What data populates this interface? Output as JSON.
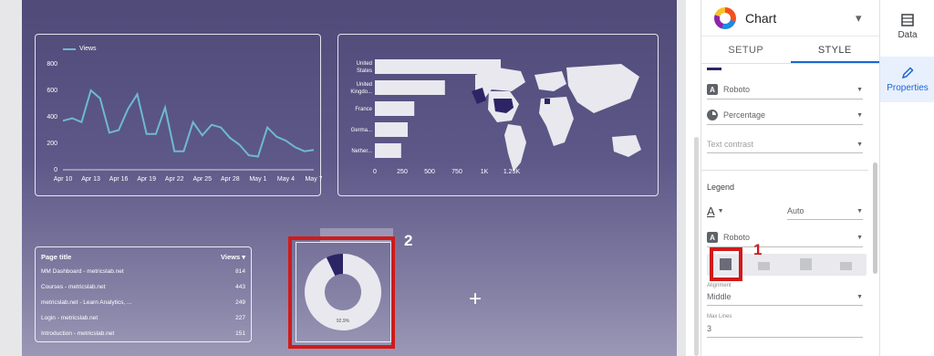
{
  "line_chart": {
    "legend": "Views",
    "x_labels": [
      "Apr 10",
      "Apr 13",
      "Apr 16",
      "Apr 19",
      "Apr 22",
      "Apr 25",
      "Apr 28",
      "May 1",
      "May 4",
      "May 7"
    ],
    "y_labels": [
      "0",
      "200",
      "400",
      "600",
      "800"
    ],
    "values": [
      370,
      390,
      360,
      600,
      540,
      280,
      300,
      460,
      570,
      270,
      270,
      470,
      140,
      140,
      360,
      260,
      340,
      320,
      240,
      190,
      110,
      100,
      320,
      250,
      220,
      170,
      140,
      150
    ],
    "ymax": 800,
    "color": "#6fb9d4"
  },
  "geo_chart": {
    "bars": [
      {
        "label_lines": [
          "United",
          "States"
        ],
        "value": 1150
      },
      {
        "label_lines": [
          "United",
          "Kingdo..."
        ],
        "value": 640
      },
      {
        "label_lines": [
          "France"
        ],
        "value": 360
      },
      {
        "label_lines": [
          "Germa..."
        ],
        "value": 300
      },
      {
        "label_lines": [
          "Nether..."
        ],
        "value": 240
      }
    ],
    "x_ticks": [
      "0",
      "250",
      "500",
      "750",
      "1K",
      "1.25K"
    ],
    "xmax": 1250
  },
  "table": {
    "col_title": "Page title",
    "col_views": "Views",
    "rows": [
      {
        "title": "MM Dashboard - metricslab.net",
        "views": "814"
      },
      {
        "title": "Courses - metricslab.net",
        "views": "443"
      },
      {
        "title": "metricslab.net - Learn Analytics, ...",
        "views": "249"
      },
      {
        "title": "Login - metricslab.net",
        "views": "227"
      },
      {
        "title": "Introduction - metricslab.net",
        "views": "151"
      }
    ]
  },
  "donut": {
    "label": "92.9%",
    "fraction": 0.929
  },
  "annotations": {
    "badge_1": "1",
    "badge_2": "2",
    "accent": "#d11a1a"
  },
  "panel": {
    "title": "Chart",
    "tab_setup": "SETUP",
    "tab_style": "STYLE",
    "font_1": "Roboto",
    "label_type": "Percentage",
    "text_contrast": "Text contrast",
    "legend_title": "Legend",
    "legend_size": "Auto",
    "font_2": "Roboto",
    "alignment_label": "Alignment",
    "alignment_value": "Middle",
    "max_lines_label": "Max Lines",
    "max_lines_value": "3"
  },
  "rail": {
    "data": "Data",
    "properties": "Properties"
  }
}
